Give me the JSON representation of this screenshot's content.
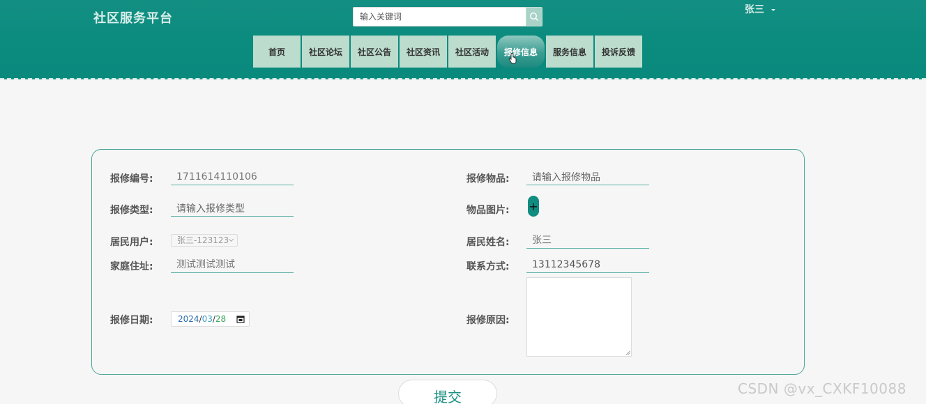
{
  "header": {
    "site_title": "社区服务平台",
    "search": {
      "placeholder": "输入关键词",
      "value": ""
    },
    "user_name": "张三"
  },
  "nav": {
    "items": [
      "首页",
      "社区论坛",
      "社区公告",
      "社区资讯",
      "社区活动",
      "报修信息",
      "服务信息",
      "投诉反馈"
    ],
    "active": "报修信息"
  },
  "form": {
    "repair_no": {
      "label": "报修编号:",
      "value": "1711614110106"
    },
    "repair_item": {
      "label": "报修物品:",
      "placeholder": "请输入报修物品"
    },
    "repair_type": {
      "label": "报修类型:",
      "placeholder": "请输入报修类型"
    },
    "item_image": {
      "label": "物品图片:",
      "button": "+"
    },
    "resident_user": {
      "label": "居民用户:",
      "value": "张三-123123"
    },
    "resident_name": {
      "label": "居民姓名:",
      "value": "张三"
    },
    "home_address": {
      "label": "家庭住址:",
      "value": "测试测试测试"
    },
    "contact": {
      "label": "联系方式:",
      "value": "13112345678"
    },
    "repair_date": {
      "label": "报修日期:",
      "year": "2024",
      "month": "03",
      "day": "28",
      "sep": "/"
    },
    "repair_reason": {
      "label": "报修原因:",
      "value": ""
    },
    "submit_label": "提交"
  },
  "watermark": "CSDN @vx_CXKF10088",
  "colors": {
    "primary": "#0c8c7f",
    "nav_bg": "#bcdccd",
    "border": "#4aa596"
  }
}
